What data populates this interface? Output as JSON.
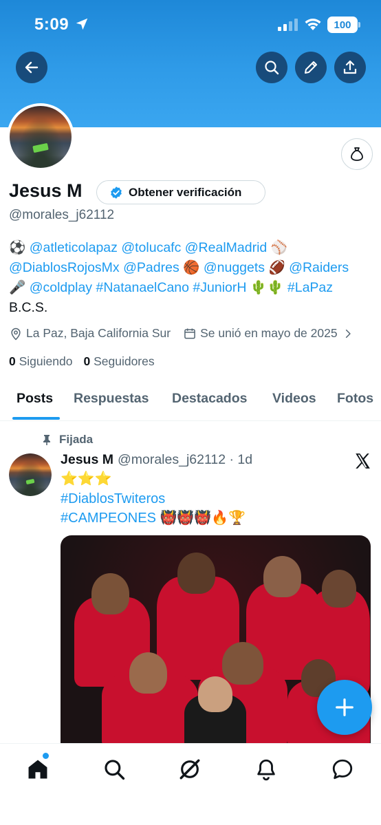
{
  "status": {
    "time": "5:09",
    "battery": "100"
  },
  "profile": {
    "name": "Jesus M",
    "verify_label": "Obtener verificación",
    "handle": "@morales_j62112",
    "bio": {
      "line1": [
        "⚽ ",
        "@atleticolapaz",
        " ",
        "@tolucafc",
        " ",
        "@RealMadrid",
        " ⚾"
      ],
      "line2": [
        "@DiablosRojosMx",
        " ",
        "@Padres",
        " 🏀 ",
        "@nuggets",
        " 🏈 ",
        "@Raiders"
      ],
      "line3": [
        "🎤 ",
        "@coldplay",
        " ",
        "#NatanaelCano",
        " ",
        "#JuniorH",
        " 🌵🌵 ",
        "#LaPaz"
      ],
      "line4": "B.C.S."
    },
    "location": "La Paz, Baja California Sur",
    "joined": "Se unió en mayo de 2025",
    "following_count": "0",
    "following_label": "Siguiendo",
    "followers_count": "0",
    "followers_label": "Seguidores"
  },
  "tabs": [
    "Posts",
    "Respuestas",
    "Destacados",
    "Videos",
    "Fotos"
  ],
  "tweet": {
    "pinned_label": "Fijada",
    "author": "Jesus M",
    "handle_time": "@morales_j62112 · 1d",
    "line1": "⭐⭐⭐",
    "line2": "#DiablosTwiteros",
    "line3_tag": "#CAMPEONES",
    "line3_emoji": " 👹👹👹🔥🏆"
  },
  "colors": {
    "accent": "#1d9bf0",
    "banner": "#2f9be8",
    "text": "#0f1419",
    "muted": "#536471"
  },
  "icons": {
    "back": "arrow-left-icon",
    "search": "search-icon",
    "edit": "pencil-icon",
    "share": "share-icon",
    "money": "money-bag-icon",
    "verified": "verified-badge-icon",
    "location": "location-pin-icon",
    "calendar": "calendar-icon",
    "pin": "pin-icon",
    "x": "x-logo-icon",
    "compose": "plus-icon",
    "nav": [
      "home-icon",
      "search-icon",
      "grok-icon",
      "bell-icon",
      "message-icon"
    ]
  }
}
